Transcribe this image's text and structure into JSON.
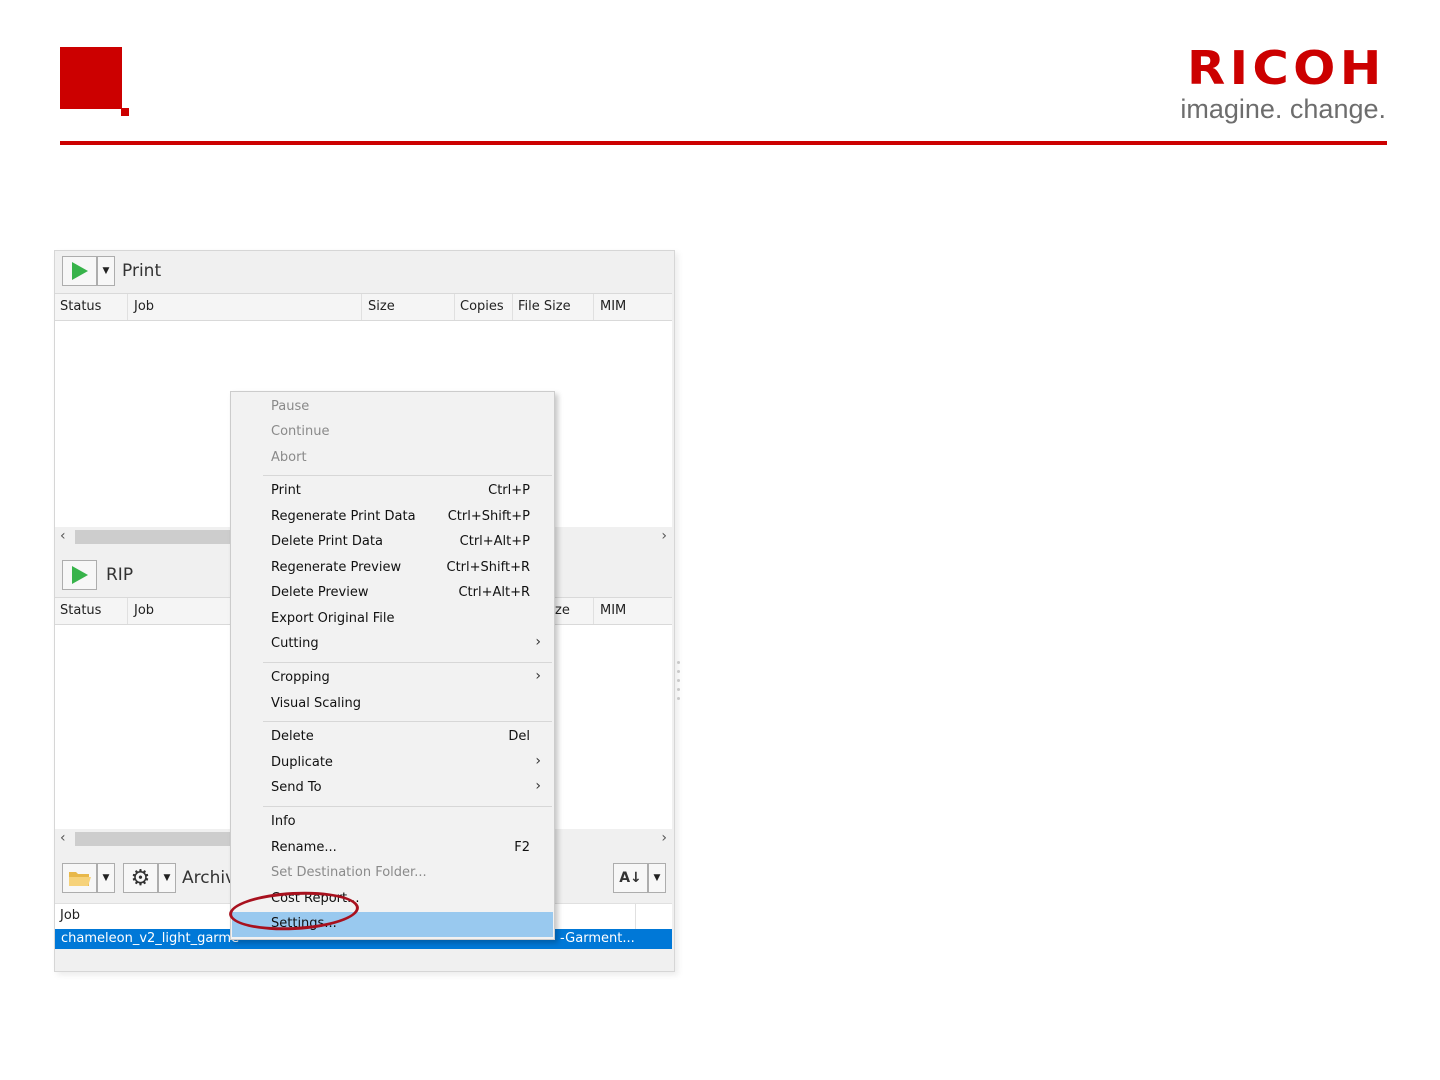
{
  "brand": {
    "name": "RICOH",
    "tagline": "imagine. change.",
    "color": "#cc0000"
  },
  "print_panel": {
    "title": "Print",
    "columns": [
      "Status",
      "Job",
      "Size",
      "Copies",
      "File Size",
      "MIM"
    ]
  },
  "rip_panel": {
    "title": "RIP",
    "columns": [
      "Status",
      "Job",
      "ze",
      "MIM"
    ]
  },
  "archive_panel": {
    "title": "Archiv",
    "column": "Job",
    "selected_row": {
      "left_text": "chameleon_v2_light_garme",
      "right_text": "-Garment..."
    }
  },
  "context_menu": {
    "highlight_color": "#99c9ef",
    "groups": [
      [
        {
          "label": "Pause",
          "enabled": false
        },
        {
          "label": "Continue",
          "enabled": false
        },
        {
          "label": "Abort",
          "enabled": false
        }
      ],
      [
        {
          "label": "Print",
          "shortcut": "Ctrl+P"
        },
        {
          "label": "Regenerate Print Data",
          "shortcut": "Ctrl+Shift+P"
        },
        {
          "label": "Delete Print Data",
          "shortcut": "Ctrl+Alt+P"
        },
        {
          "label": "Regenerate Preview",
          "shortcut": "Ctrl+Shift+R"
        },
        {
          "label": "Delete Preview",
          "shortcut": "Ctrl+Alt+R"
        },
        {
          "label": "Export Original File"
        },
        {
          "label": "Cutting",
          "submenu": true
        }
      ],
      [
        {
          "label": "Cropping",
          "submenu": true
        },
        {
          "label": "Visual Scaling"
        }
      ],
      [
        {
          "label": "Delete",
          "shortcut": "Del"
        },
        {
          "label": "Duplicate",
          "submenu": true
        },
        {
          "label": "Send To",
          "submenu": true
        }
      ],
      [
        {
          "label": "Info"
        },
        {
          "label": "Rename...",
          "shortcut": "F2"
        },
        {
          "label": "Set Destination Folder...",
          "enabled": false
        },
        {
          "label": "Cost Report..."
        },
        {
          "label": "Settings...",
          "highlighted": true
        }
      ]
    ]
  },
  "annotation": {
    "circle_color": "#a8111e"
  }
}
